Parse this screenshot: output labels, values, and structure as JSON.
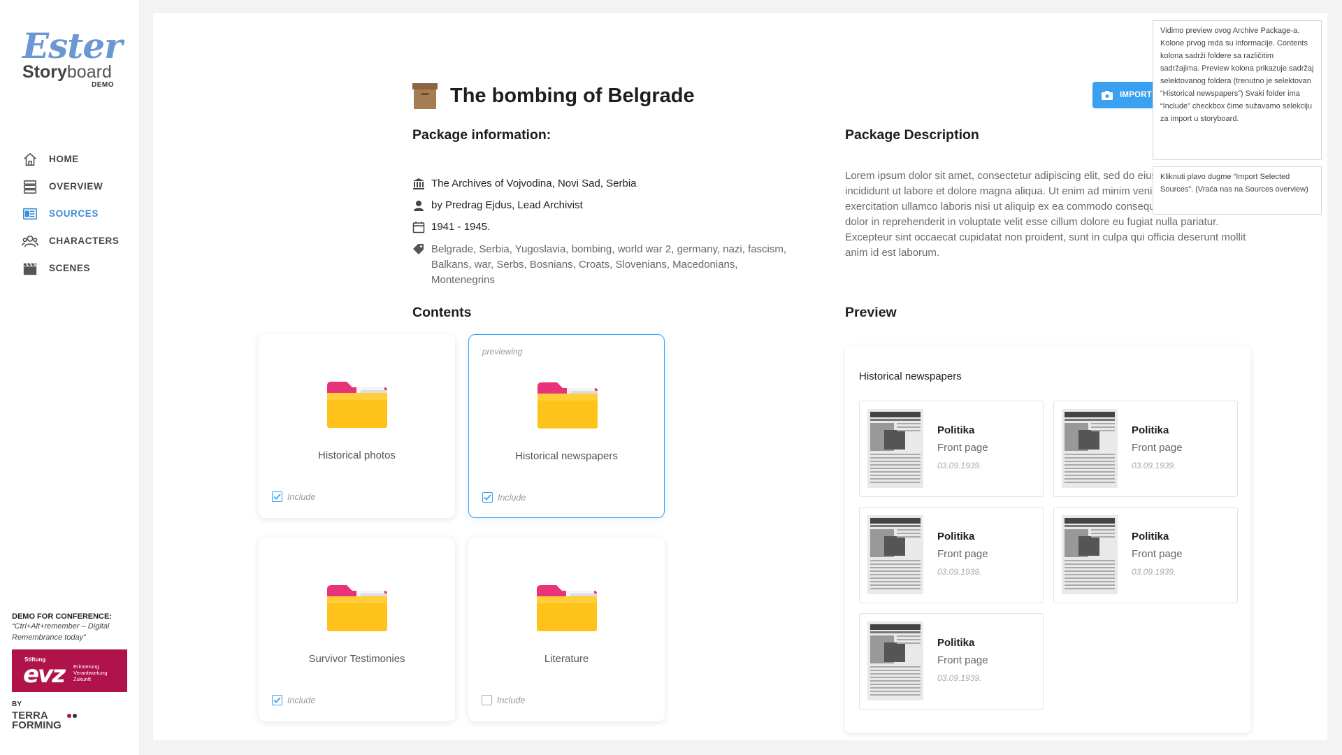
{
  "sidebar": {
    "logo_script": "Ester",
    "logo_bold": "Story",
    "logo_light": "board",
    "logo_demo": "DEMO",
    "nav": [
      {
        "label": "HOME",
        "icon": "home-icon"
      },
      {
        "label": "OVERVIEW",
        "icon": "stack-icon"
      },
      {
        "label": "SOURCES",
        "icon": "sources-icon"
      },
      {
        "label": "CHARACTERS",
        "icon": "characters-icon"
      },
      {
        "label": "SCENES",
        "icon": "clapperboard-icon"
      }
    ],
    "active_nav": "SOURCES",
    "conf_title": "DEMO FOR CONFERENCE:",
    "conf_text": "“Ctrl+Alt+remember – Digital Remembrance today”",
    "evz_stiftung": "Stiftung",
    "evz_logo": "evz",
    "evz_line1": "Erinnerung",
    "evz_line2": "Verantwortung",
    "evz_line3": "Zukunft",
    "by": "BY",
    "terra_line1": "TERRA",
    "terra_line2": "FORMING"
  },
  "header": {
    "title": "The bombing of Belgrade",
    "import_button": "IMPORT SELECTED SOURCES"
  },
  "package_info": {
    "heading": "Package information:",
    "archive": "The Archives of Vojvodina, Novi Sad, Serbia",
    "author": "by Predrag Ejdus, Lead Archivist",
    "dates": "1941 - 1945.",
    "tags": "Belgrade, Serbia, Yugoslavia, bombing, world war 2, germany, nazi, fascism, Balkans, war, Serbs, Bosnians, Croats, Slovenians, Macedonians, Montenegrins"
  },
  "package_description": {
    "heading": "Package Description",
    "text": "Lorem ipsum dolor sit amet, consectetur adipiscing elit, sed do eiusmod tempor incididunt ut labore et dolore magna aliqua. Ut enim ad minim veniam, quis nostrud exercitation ullamco laboris nisi ut aliquip ex ea commodo consequat. Duis aute irure dolor in reprehenderit in voluptate velit esse cillum dolore eu fugiat nulla pariatur. Excepteur sint occaecat cupidatat non proident, sunt in culpa qui officia deserunt mollit anim id est laborum."
  },
  "contents": {
    "heading": "Contents",
    "previewing_label": "previewing",
    "include_label": "Include",
    "folders": [
      {
        "label": "Historical photos",
        "included": true,
        "selected": false
      },
      {
        "label": "Historical newspapers",
        "included": true,
        "selected": true
      },
      {
        "label": "Survivor Testimonies",
        "included": true,
        "selected": false
      },
      {
        "label": "Literature",
        "included": false,
        "selected": false
      }
    ]
  },
  "preview": {
    "heading": "Preview",
    "folder_title": "Historical newspapers",
    "items": [
      {
        "title": "Politika",
        "subtitle": "Front page",
        "date": "03.09.1939."
      },
      {
        "title": "Politika",
        "subtitle": "Front page",
        "date": "03.09.1939."
      },
      {
        "title": "Politika",
        "subtitle": "Front page",
        "date": "03.09.1939."
      },
      {
        "title": "Politika",
        "subtitle": "Front page",
        "date": "03.09.1939."
      },
      {
        "title": "Politika",
        "subtitle": "Front page",
        "date": "03.09.1939."
      }
    ]
  },
  "notes": {
    "note1": "Vidimo preview ovog Archive Package-a. Kolone prvog reda su informacije. Contents kolona sadrži foldere sa različitim sadržajima. Preview kolona prikazuje sadržaj selektovanog foldera (trenutno je selektovan “Historical newspapers”) Svaki folder ima “Include” checkbox čime sužavamo selekciju za import u storyboard.",
    "note2": "Kliknuti plavo dugme “Import Selected Sources”. (Vraća nas na Sources overview)"
  },
  "colors": {
    "accent": "#3aa0f0",
    "nav_active": "#3d8ed8",
    "folder": "#ffc21a",
    "evz": "#b0124a"
  }
}
